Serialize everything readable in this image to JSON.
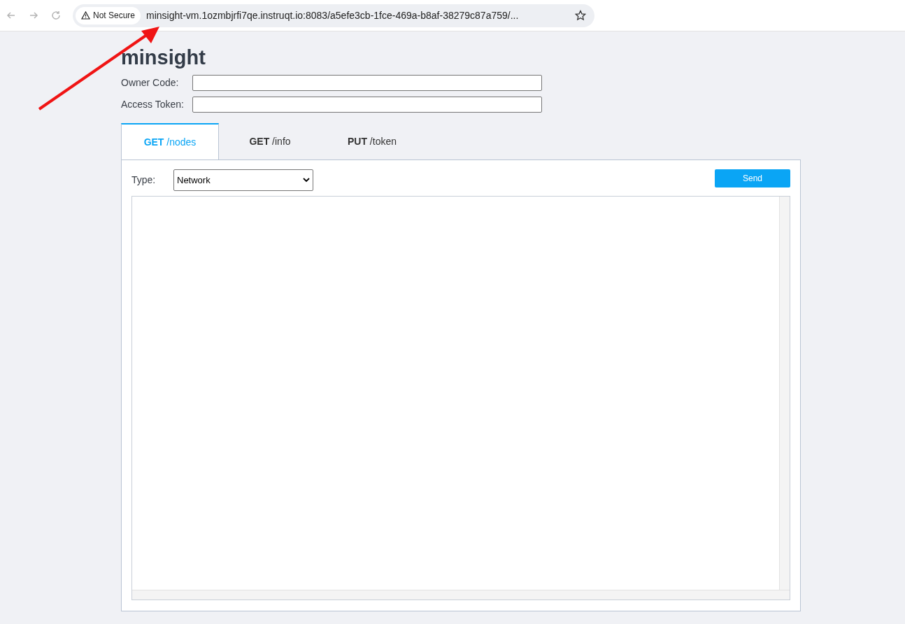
{
  "browser": {
    "security_label": "Not Secure",
    "url": "minsight-vm.1ozmbjrfi7qe.instruqt.io:8083/a5efe3cb-1fce-469a-b8af-38279c87a759/..."
  },
  "title": "minsight",
  "fields": [
    {
      "label": "Owner Code:"
    },
    {
      "label": "Access Token:"
    }
  ],
  "tabs": [
    {
      "label": "**GET** /nodes",
      "selected": true
    },
    {
      "label": "**GET** /info",
      "selected": false
    },
    {
      "label": "**PUT** /token",
      "selected": false
    }
  ],
  "panel": {
    "type_label": "Type:",
    "type_value": "Network",
    "send_button": "Send"
  }
}
